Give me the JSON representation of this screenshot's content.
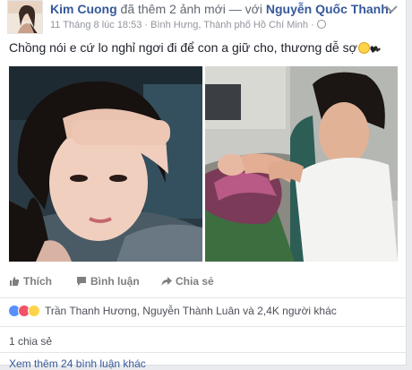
{
  "post": {
    "author": "Kim Cuong",
    "action_text": "đã thêm 2 ảnh mới — với",
    "tagged_friend": "Nguyễn Quốc Thanh.",
    "date": "11 Tháng 8 lúc 18:53 · Bình Hưng, Thành phố Hồ Chí Minh ·",
    "body": "Chồng nói e cứ lo nghỉ ngơi đi để con a giữ cho, thương dễ sợ"
  },
  "actions": {
    "like": "Thích",
    "comment": "Bình luận",
    "share": "Chia sẻ"
  },
  "reactions": {
    "people": "Trần Thanh Hương, Nguyễn Thành Luân và 2,4K người khác"
  },
  "shares": "1 chia sẻ",
  "more_comments": "Xem thêm 24 bình luận khác",
  "icons": [
    "globe-icon",
    "chevron-down-icon",
    "like-icon",
    "comment-icon",
    "share-icon",
    "like-reaction-icon",
    "love-reaction-icon",
    "haha-reaction-icon",
    "smile-emoji-icon",
    "heart-emoji-icon"
  ],
  "colors": {
    "link": "#365899",
    "meta": "#90949c",
    "like_blue": "#5890ff",
    "love_red": "#f25268",
    "haha_yellow": "#ffd44a"
  }
}
